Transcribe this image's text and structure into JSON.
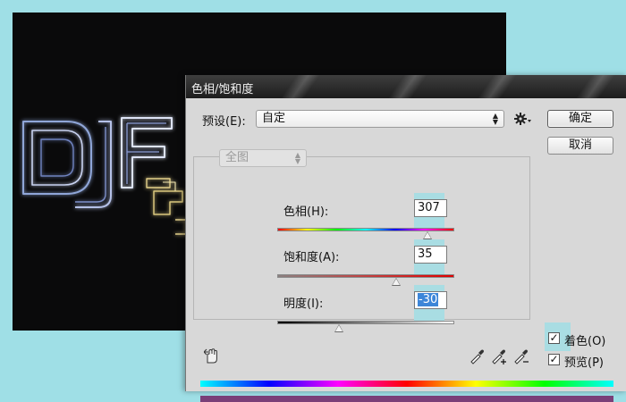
{
  "dialog": {
    "title": "色相/饱和度",
    "preset_label": "预设(E):",
    "preset_value": "自定",
    "ok_label": "确定",
    "cancel_label": "取消",
    "channel_value": "全图",
    "hue": {
      "label": "色相(H):",
      "value": "307",
      "fraction": 0.85
    },
    "saturation": {
      "label": "饱和度(A):",
      "value": "35",
      "fraction": 0.67
    },
    "lightness": {
      "label": "明度(I):",
      "value": "-30",
      "fraction": 0.35
    },
    "colorize_label": "着色(O)",
    "colorize_checked": true,
    "preview_label": "预览(P)",
    "preview_checked": true
  },
  "icons": {
    "settings": "gear-icon",
    "hand_tool": "hand-adjust-icon",
    "eyedropper": "eyedropper-icon",
    "eyedropper_plus": "eyedropper-plus-icon",
    "eyedropper_minus": "eyedropper-minus-icon"
  },
  "colors": {
    "page_background": "#9fdfe6",
    "canvas": "#0a0a0b",
    "result_bar": "#7a3f78",
    "highlight": "#a9dde3",
    "selection": "#3d86d8"
  }
}
